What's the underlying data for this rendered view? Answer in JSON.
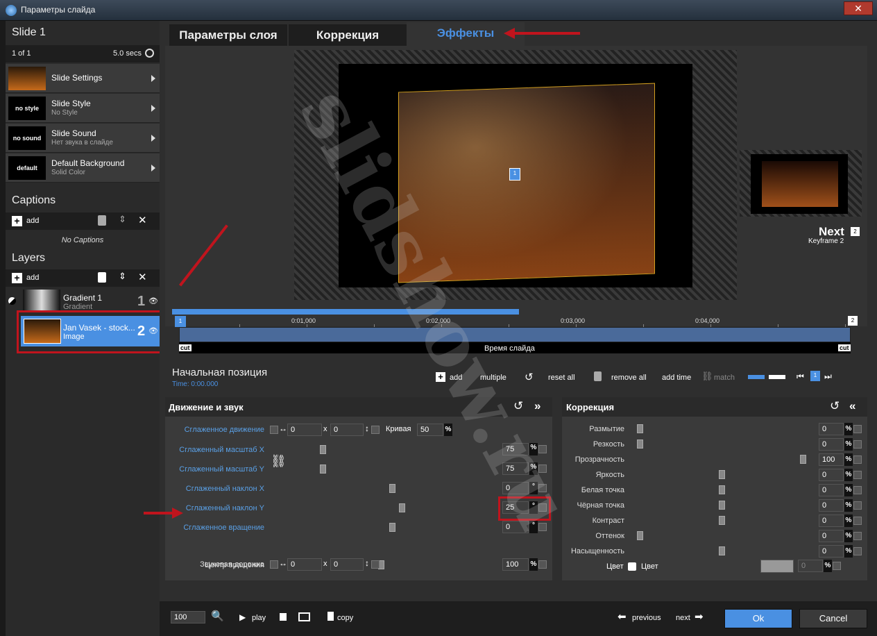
{
  "window": {
    "title": "Параметры слайда",
    "close": "✕"
  },
  "left": {
    "slide_title": "Slide 1",
    "slide_count": "1 of 1",
    "slide_duration": "5.0 secs",
    "items": [
      {
        "thumb": "",
        "label": "Slide Settings",
        "sub": ""
      },
      {
        "thumb": "no style",
        "label": "Slide Style",
        "sub": "No Style"
      },
      {
        "thumb": "no sound",
        "label": "Slide Sound",
        "sub": "Нет звука в слайде"
      },
      {
        "thumb": "default",
        "label": "Default Background",
        "sub": "Solid Color"
      }
    ],
    "captions_header": "Captions",
    "add": "add",
    "no_captions": "No Captions",
    "layers_header": "Layers",
    "layers": [
      {
        "name": "Gradient 1",
        "type": "Gradient",
        "num": "1"
      },
      {
        "name": "Jan Vasek - stock...",
        "type": "Image",
        "num": "2"
      }
    ]
  },
  "tabs": [
    "Параметры слоя",
    "Коррекция",
    "Эффекты"
  ],
  "preview": {
    "marker": "1",
    "next": "Next",
    "next_num": "2",
    "next_sub": "Keyframe 2"
  },
  "timeline": {
    "ticks": [
      "0:01,000",
      "0:02,000",
      "0:03,000",
      "0:04,000"
    ],
    "start_marker": "1",
    "end_marker": "2",
    "cut": "cut",
    "label": "Время слайда"
  },
  "keyframe": {
    "title": "Начальная позиция",
    "time": "Time: 0:00.000",
    "add": "add",
    "multiple": "multiple",
    "reset_all": "reset all",
    "remove_all": "remove all",
    "add_time": "add time",
    "match": "match",
    "marker": "1"
  },
  "motion": {
    "title": "Движение и звук",
    "smooth_move": "Сглаженное движение",
    "x": "0",
    "y": "0",
    "x_sep": "x",
    "curve_label": "Кривая",
    "curve": "50",
    "pct": "%",
    "rows": [
      {
        "label": "Сглаженный масштаб X",
        "value": "75",
        "unit": "%",
        "level": 0.13,
        "blue": true
      },
      {
        "label": "Сглаженный масштаб Y",
        "value": "75",
        "unit": "%",
        "level": 0.13,
        "blue": true
      },
      {
        "label": "Сглаженный наклон X",
        "value": "0",
        "unit": "°",
        "level": 0.5,
        "blue": true
      },
      {
        "label": "Сглаженный наклон Y",
        "value": "25",
        "unit": "°",
        "level": 0.55,
        "blue": true
      },
      {
        "label": "Сглаженное вращение",
        "value": "0",
        "unit": "°",
        "level": 0.5,
        "blue": true
      }
    ],
    "center_label": "Центр вращения",
    "cx": "0",
    "cy": "0",
    "audio_label": "Звуковая дорожка",
    "audio": "100",
    "audio_unit": "%"
  },
  "correction": {
    "title": "Коррекция",
    "rows": [
      {
        "label": "Размытие",
        "value": "0",
        "level": 0
      },
      {
        "label": "Резкость",
        "value": "0",
        "level": 0
      },
      {
        "label": "Прозрачность",
        "value": "100",
        "level": 1
      },
      {
        "label": "Яркость",
        "value": "0",
        "level": 0.5
      },
      {
        "label": "Белая точка",
        "value": "0",
        "level": 0.5
      },
      {
        "label": "Чёрная точка",
        "value": "0",
        "level": 0.5
      },
      {
        "label": "Контраст",
        "value": "0",
        "level": 0.5
      },
      {
        "label": "Оттенок",
        "value": "0",
        "level": 0
      },
      {
        "label": "Насыщенность",
        "value": "0",
        "level": 0.5
      }
    ],
    "unit": "%",
    "color_label": "Цвет",
    "color_text": "Цвет",
    "color_value": "0"
  },
  "bottom": {
    "zoom": "100",
    "play": "play",
    "copy": "copy",
    "previous": "previous",
    "next": "next",
    "ok": "Ok",
    "cancel": "Cancel"
  },
  "watermark": "slidshow.ru",
  "colors": {
    "accent": "#4a90e2",
    "red": "#c0141d"
  }
}
